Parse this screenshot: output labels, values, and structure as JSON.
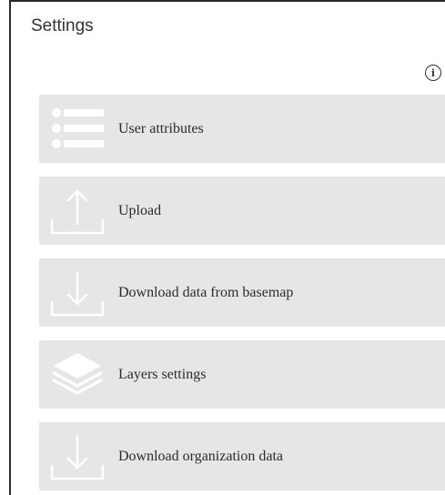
{
  "panel": {
    "title": "Settings",
    "info_icon": "info-icon",
    "info_glyph": "i"
  },
  "items": [
    {
      "label": "User attributes",
      "icon": "list-icon"
    },
    {
      "label": "Upload",
      "icon": "upload-icon"
    },
    {
      "label": "Download data from basemap",
      "icon": "download-icon"
    },
    {
      "label": "Layers settings",
      "icon": "layers-icon"
    },
    {
      "label": "Download organization data",
      "icon": "download-icon"
    }
  ],
  "colors": {
    "item_background": "#e6e6e6",
    "icon_color": "#ffffff",
    "text": "#2b2b2b",
    "border": "#2b2b2b"
  }
}
